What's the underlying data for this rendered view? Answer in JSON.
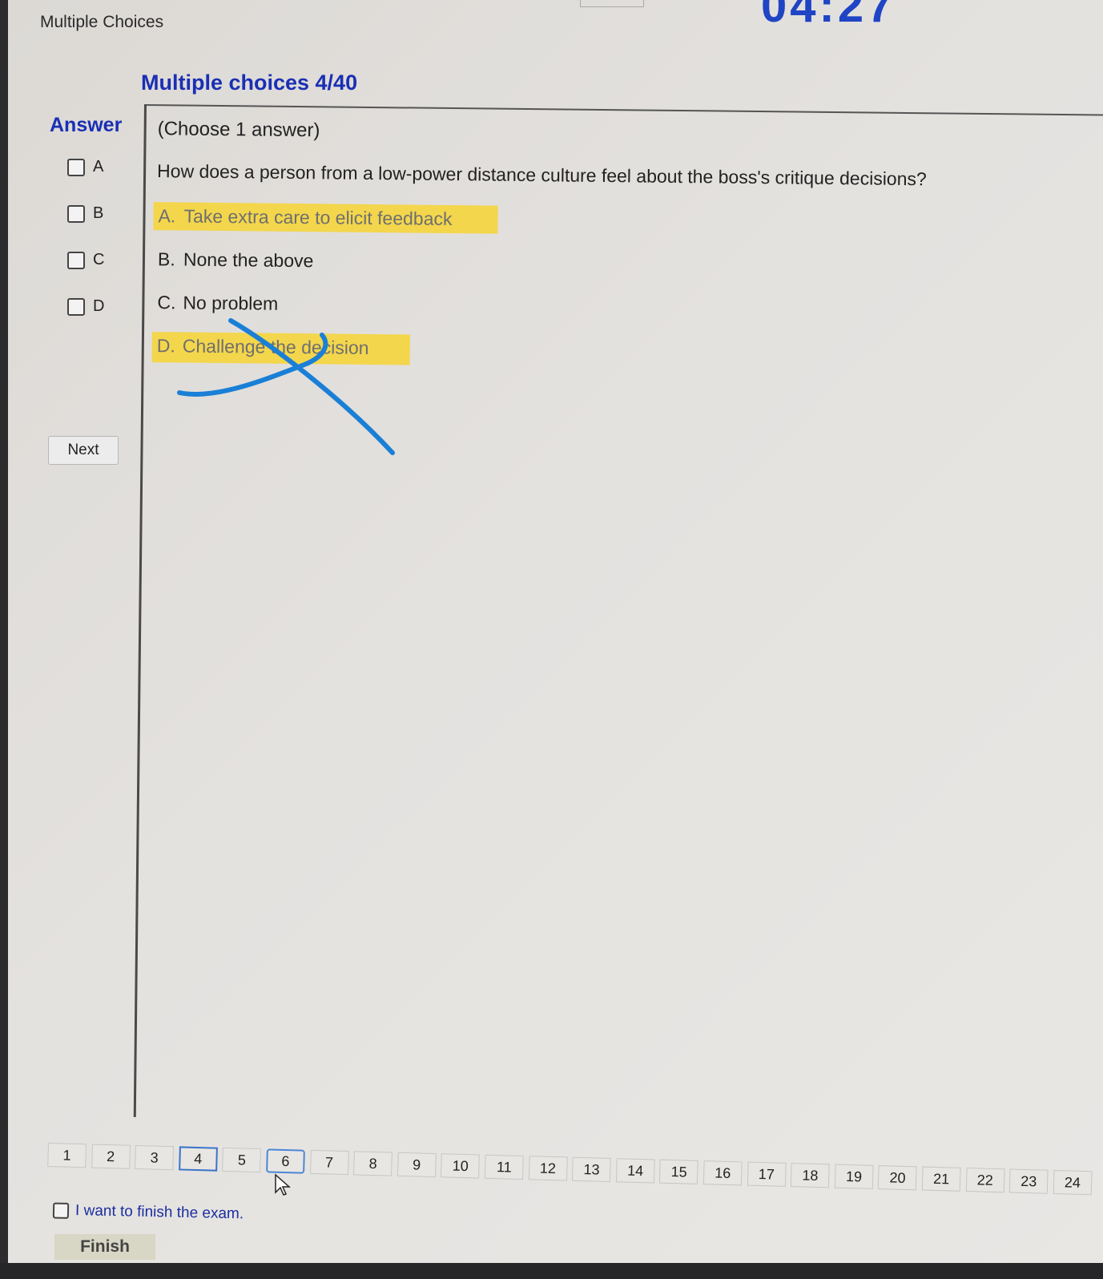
{
  "window": {
    "title": "Multiple Choices",
    "timer": "04:27"
  },
  "section": {
    "title": "Multiple choices 4/40"
  },
  "answer_panel": {
    "label": "Answer",
    "options": [
      {
        "key": "A",
        "checked": false
      },
      {
        "key": "B",
        "checked": false
      },
      {
        "key": "C",
        "checked": false
      },
      {
        "key": "D",
        "checked": false
      }
    ],
    "next_label": "Next"
  },
  "question": {
    "instruction": "(Choose 1 answer)",
    "text": "How does a person from a low-power distance culture feel about the boss's critique decisions?",
    "choices": [
      {
        "letter": "A.",
        "text": "Take extra care to elicit feedback",
        "highlighted": true
      },
      {
        "letter": "B.",
        "text": "None the above",
        "highlighted": false
      },
      {
        "letter": "C.",
        "text": "No problem",
        "highlighted": false
      },
      {
        "letter": "D.",
        "text": "Challenge the decision",
        "highlighted": true
      }
    ],
    "highlight_color": "#f3d64c",
    "annotation_color": "#1a7fd6"
  },
  "pager": {
    "pages": [
      "1",
      "2",
      "3",
      "4",
      "5",
      "6",
      "7",
      "8",
      "9",
      "10",
      "11",
      "12",
      "13",
      "14",
      "15",
      "16",
      "17",
      "18",
      "19",
      "20",
      "21",
      "22",
      "23",
      "24"
    ],
    "current": "6",
    "visited": "4",
    "current_border_color": "#4b86d6"
  },
  "finish": {
    "checkbox_label": "I want to finish the exam.",
    "button_label": "Finish",
    "checked": false
  },
  "colors": {
    "heading": "#1a2fb4",
    "background": "#dedbd7"
  }
}
